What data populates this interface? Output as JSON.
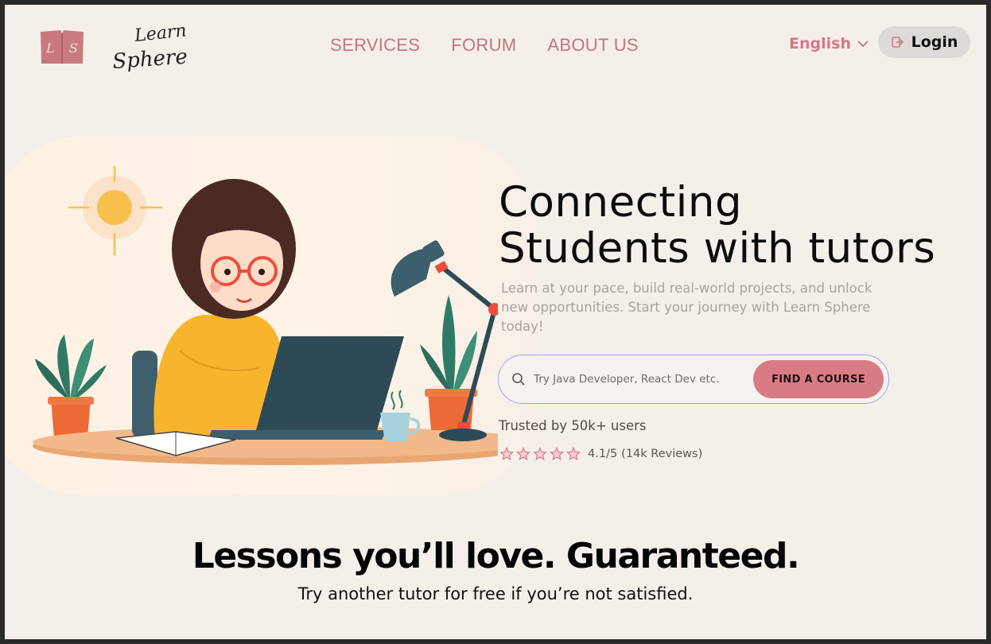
{
  "header": {
    "logo_letters": "L S",
    "logo_script": "Learn Sphere",
    "nav": [
      "SERVICES",
      "FORUM",
      "ABOUT US"
    ],
    "language": "English",
    "login_label": "Login"
  },
  "hero": {
    "headline_line1": "Connecting",
    "headline_line2": "Students with tutors",
    "subtext": "Learn at your pace, build real-world projects, and unlock new opportunities. Start your journey with Learn Sphere today!",
    "search_placeholder": "Try Java Developer, React Dev etc.",
    "search_button": "FIND A COURSE",
    "trusted": "Trusted by 50k+ users",
    "rating_value": "4.1/5",
    "rating_reviews": "(14k Reviews)",
    "stars": 5
  },
  "guarantee": {
    "title": "Lessons you’ll love. Guaranteed.",
    "subtitle": "Try another tutor for free if you’re not satisfied."
  },
  "colors": {
    "accent": "#d97b85",
    "nav": "#c4757a",
    "background": "#f5efea"
  }
}
